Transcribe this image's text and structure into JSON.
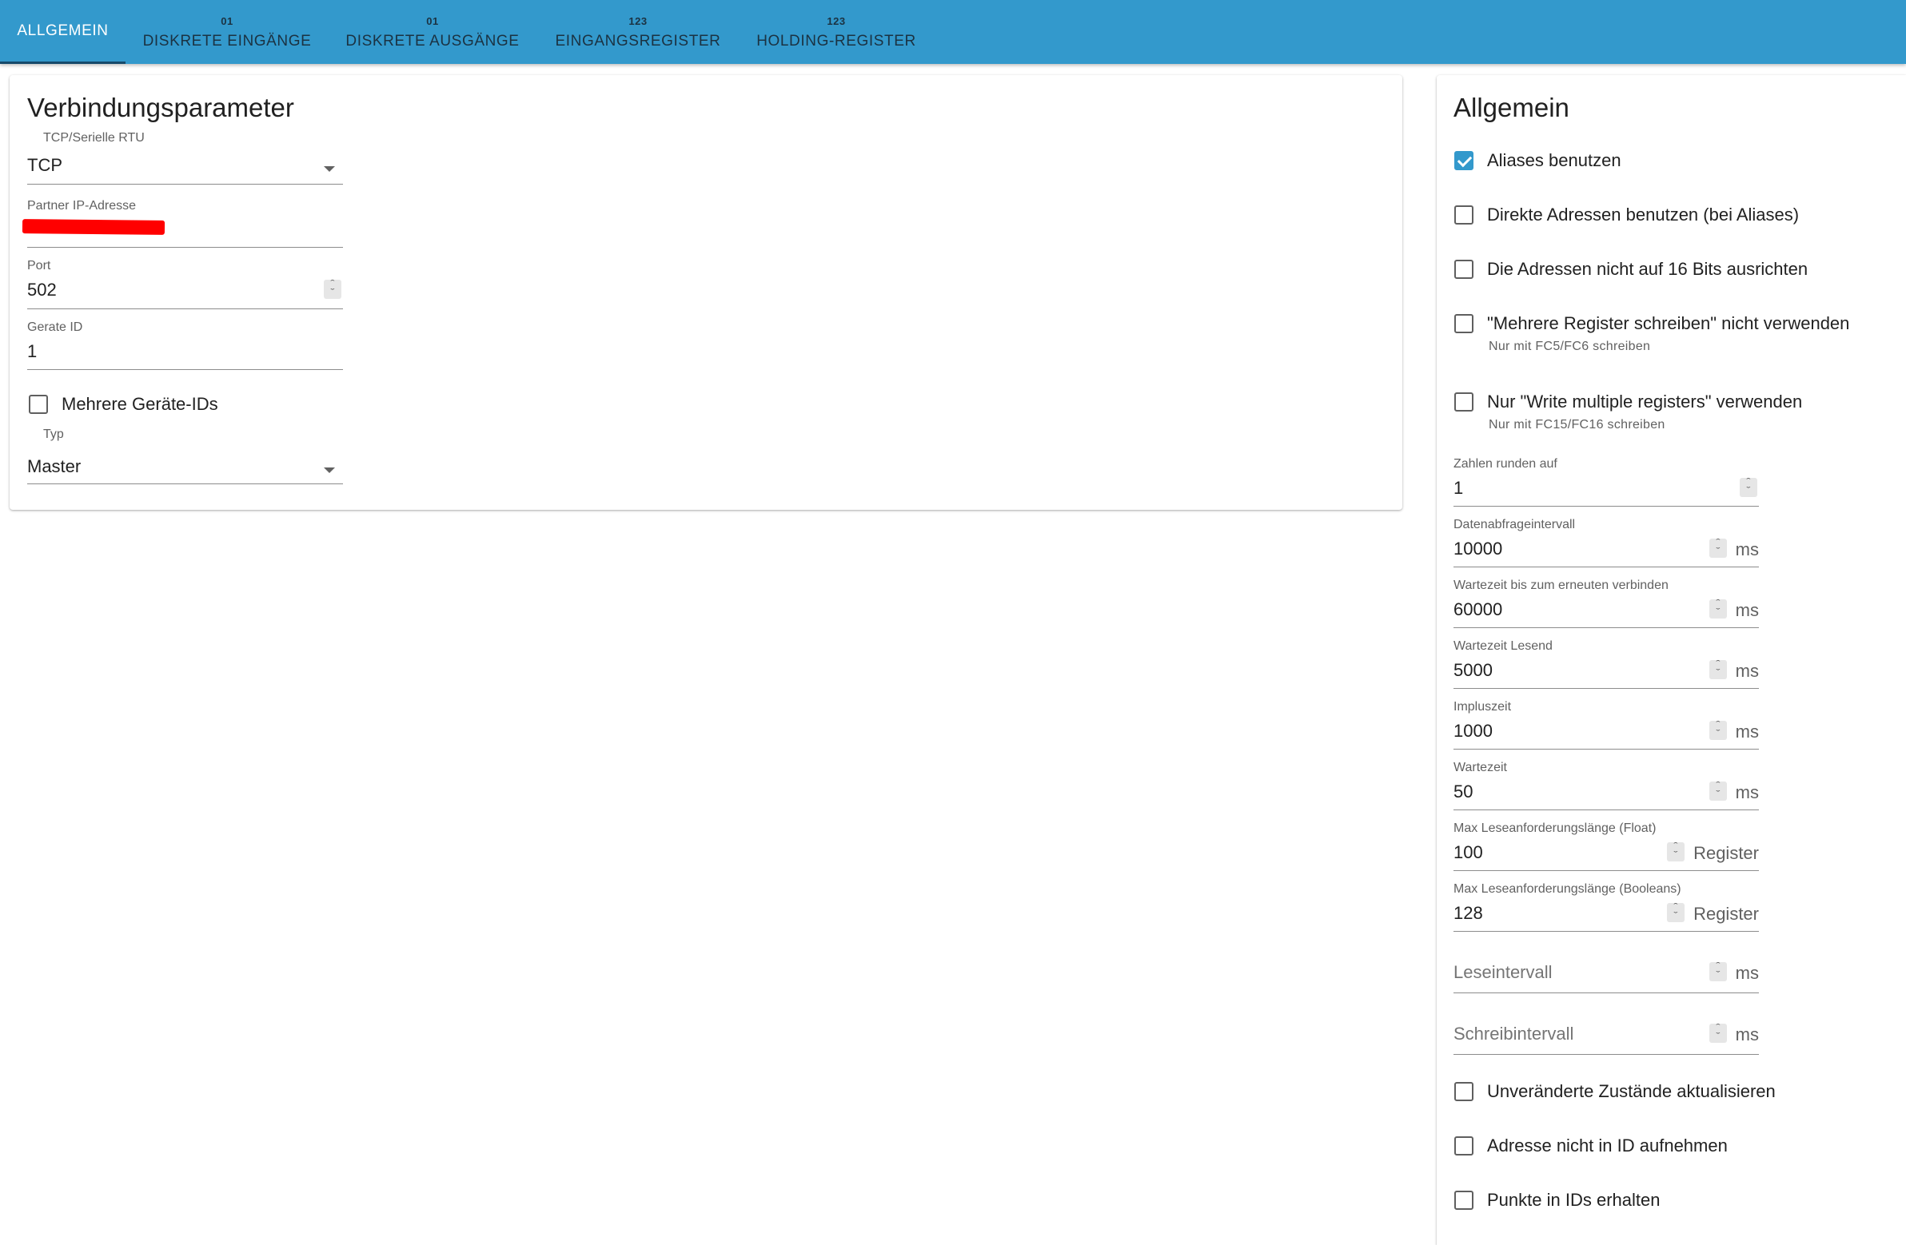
{
  "tabs": [
    {
      "label": "ALLGEMEIN",
      "icon": "",
      "active": true
    },
    {
      "label": "DISKRETE EINGÄNGE",
      "icon": "01",
      "active": false
    },
    {
      "label": "DISKRETE AUSGÄNGE",
      "icon": "01",
      "active": false
    },
    {
      "label": "EINGANGSREGISTER",
      "icon": "123",
      "active": false
    },
    {
      "label": "HOLDING-REGISTER",
      "icon": "123",
      "active": false
    }
  ],
  "left_panel": {
    "title": "Verbindungsparameter",
    "connection_type": {
      "label": "TCP/Serielle RTU",
      "value": "TCP"
    },
    "partner_ip": {
      "label": "Partner IP-Adresse",
      "value": ""
    },
    "port": {
      "label": "Port",
      "value": "502"
    },
    "device_id": {
      "label": "Gerate ID",
      "value": "1"
    },
    "multiple_ids": {
      "label": "Mehrere Geräte-IDs",
      "checked": false
    },
    "type": {
      "label": "Typ",
      "value": "Master"
    }
  },
  "right_panel": {
    "title": "Allgemein",
    "checkboxes_top": [
      {
        "label": "Aliases benutzen",
        "hint": "",
        "checked": true
      },
      {
        "label": "Direkte Adressen benutzen (bei Aliases)",
        "hint": "",
        "checked": false
      },
      {
        "label": "Die Adressen nicht auf 16 Bits ausrichten",
        "hint": "",
        "checked": false
      },
      {
        "label": "\"Mehrere Register schreiben\" nicht verwenden",
        "hint": "Nur mit FC5/FC6 schreiben",
        "checked": false
      },
      {
        "label": "Nur \"Write multiple registers\" verwenden",
        "hint": "Nur mit FC15/FC16 schreiben",
        "checked": false
      }
    ],
    "number_fields": [
      {
        "label": "Zahlen runden auf",
        "value": "1",
        "unit": ""
      },
      {
        "label": "Datenabfrageintervall",
        "value": "10000",
        "unit": "ms"
      },
      {
        "label": "Wartezeit bis zum erneuten verbinden",
        "value": "60000",
        "unit": "ms"
      },
      {
        "label": "Wartezeit Lesend",
        "value": "5000",
        "unit": "ms"
      },
      {
        "label": "Impluszeit",
        "value": "1000",
        "unit": "ms"
      },
      {
        "label": "Wartezeit",
        "value": "50",
        "unit": "ms"
      },
      {
        "label": "Max Leseanforderungslänge (Float)",
        "value": "100",
        "unit": "Register"
      },
      {
        "label": "Max Leseanforderungslänge (Booleans)",
        "value": "128",
        "unit": "Register"
      }
    ],
    "empty_fields": [
      {
        "placeholder": "Leseintervall",
        "unit": "ms"
      },
      {
        "placeholder": "Schreibintervall",
        "unit": "ms"
      }
    ],
    "checkboxes_bottom": [
      {
        "label": "Unveränderte Zustände aktualisieren",
        "checked": false
      },
      {
        "label": "Adresse nicht in ID aufnehmen",
        "checked": false
      },
      {
        "label": "Punkte in IDs erhalten",
        "checked": false
      }
    ]
  },
  "colors": {
    "primary": "#3399cc",
    "redaction": "#ff0000"
  }
}
